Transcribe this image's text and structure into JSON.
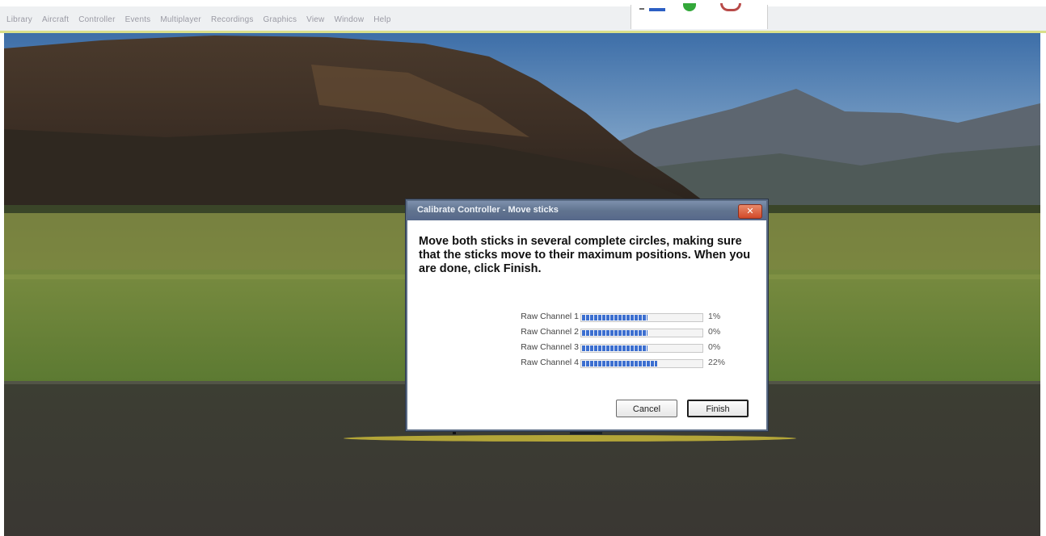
{
  "menubar": {
    "items": [
      "Library",
      "Aircraft",
      "Controller",
      "Events",
      "Multiplayer",
      "Recordings",
      "Graphics",
      "View",
      "Window",
      "Help"
    ]
  },
  "toolbar": {
    "icons": [
      "minus-icon",
      "green-check-icon",
      "tool-icon"
    ]
  },
  "dialog": {
    "title": "Calibrate Controller - Move sticks",
    "instruction": "Move both sticks in several complete circles, making sure that the sticks move to their maximum positions. When you are done, click Finish.",
    "channels": [
      {
        "label": "Raw Channel 1",
        "value": "1%",
        "fill_fraction": 0.55
      },
      {
        "label": "Raw Channel 2",
        "value": "0%",
        "fill_fraction": 0.55
      },
      {
        "label": "Raw Channel 3",
        "value": "0%",
        "fill_fraction": 0.55
      },
      {
        "label": "Raw Channel 4",
        "value": "22%",
        "fill_fraction": 0.63
      }
    ],
    "cancel_label": "Cancel",
    "finish_label": "Finish",
    "close_icon": "close-icon"
  },
  "colors": {
    "titlebar": "#61748f",
    "progress_fill": "#3c6fd0",
    "close_button": "#d24a2a"
  }
}
